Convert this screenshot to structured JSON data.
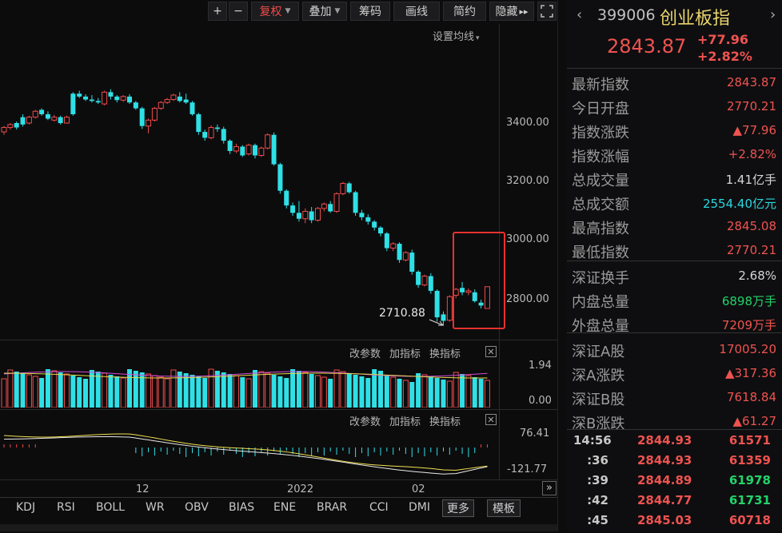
{
  "toolbar": {
    "plus": "+",
    "minus": "−",
    "fuquan": "复权",
    "diejia": "叠加",
    "chouma": "筹码",
    "huaxian": "画线",
    "jianyue": "简约",
    "yincang": "隐藏",
    "more_arrows": "▸▸"
  },
  "main_chart": {
    "ma_setting": "设置均线",
    "y_ticks": [
      "3400.00",
      "3200.00",
      "3000.00",
      "2800.00"
    ],
    "low_annotation": "2710.88",
    "highlight_color": "#e8322e"
  },
  "volume_panel": {
    "tools": [
      "改参数",
      "加指标",
      "换指标"
    ],
    "close": "✕",
    "y_ticks": [
      "1.94",
      "0.00"
    ]
  },
  "macd_panel": {
    "tools": [
      "改参数",
      "加指标",
      "换指标"
    ],
    "close": "✕",
    "y_ticks": [
      "76.41",
      "-121.77"
    ]
  },
  "x_axis": [
    "12",
    "2022",
    "02"
  ],
  "bottom_tabs": [
    "KDJ",
    "RSI",
    "BOLL",
    "WR",
    "OBV",
    "BIAS",
    "ENE",
    "BRAR",
    "CCI",
    "DMI",
    "更多",
    "模板"
  ],
  "expand": "»",
  "quote": {
    "code": "399006",
    "name": "创业板指",
    "price": "2843.87",
    "change": "+77.96",
    "pct": "+2.82%",
    "rows": [
      {
        "label": "最新指数",
        "value": "2843.87",
        "color": "red"
      },
      {
        "label": "今日开盘",
        "value": "2770.21",
        "color": "red"
      },
      {
        "label": "指数涨跌",
        "value": "▲77.96",
        "color": "red"
      },
      {
        "label": "指数涨幅",
        "value": "+2.82%",
        "color": "red"
      },
      {
        "label": "总成交量",
        "value": "1.41亿手",
        "color": "white"
      },
      {
        "label": "总成交额",
        "value": "2554.40亿元",
        "color": "cyan"
      },
      {
        "label": "最高指数",
        "value": "2845.08",
        "color": "red"
      },
      {
        "label": "最低指数",
        "value": "2770.21",
        "color": "red"
      },
      {
        "label": "深证换手",
        "value": "2.68%",
        "color": "white"
      },
      {
        "label": "内盘总量",
        "value": "6898万手",
        "color": "green"
      },
      {
        "label": "外盘总量",
        "value": "7209万手",
        "color": "red"
      },
      {
        "label": "深证A股",
        "value": "17005.20",
        "color": "red"
      },
      {
        "label": "深A涨跌",
        "value": "▲317.36",
        "color": "red"
      },
      {
        "label": "深证B股",
        "value": "7618.84",
        "color": "red"
      },
      {
        "label": "深B涨跌",
        "value": "▲61.27",
        "color": "red"
      }
    ],
    "ticks": [
      {
        "time": "14:56",
        "price": "2844.93",
        "vol": "61571",
        "color": "red"
      },
      {
        "time": ":36",
        "price": "2844.93",
        "vol": "61359",
        "color": "red"
      },
      {
        "time": ":39",
        "price": "2844.89",
        "vol": "61978",
        "color": "green"
      },
      {
        "time": ":42",
        "price": "2844.77",
        "vol": "61731",
        "color": "green"
      },
      {
        "time": ":45",
        "price": "2845.03",
        "vol": "60718",
        "color": "red"
      }
    ]
  },
  "chart_data": {
    "type": "candlestick",
    "y_ticks": [
      3400,
      3200,
      3000,
      2800
    ],
    "candles": [
      [
        3370,
        3385,
        3360,
        3390
      ],
      [
        3385,
        3395,
        3378,
        3400
      ],
      [
        3400,
        3385,
        3378,
        3405
      ],
      [
        3420,
        3395,
        3388,
        3430
      ],
      [
        3400,
        3420,
        3395,
        3425
      ],
      [
        3420,
        3440,
        3415,
        3445
      ],
      [
        3445,
        3430,
        3425,
        3450
      ],
      [
        3430,
        3415,
        3410,
        3440
      ],
      [
        3410,
        3420,
        3405,
        3428
      ],
      [
        3420,
        3400,
        3395,
        3425
      ],
      [
        3400,
        3420,
        3398,
        3425
      ],
      [
        3500,
        3430,
        3425,
        3505
      ],
      [
        3500,
        3490,
        3485,
        3510
      ],
      [
        3490,
        3480,
        3475,
        3498
      ],
      [
        3480,
        3475,
        3470,
        3495
      ],
      [
        3475,
        3470,
        3465,
        3485
      ],
      [
        3465,
        3505,
        3460,
        3510
      ],
      [
        3505,
        3490,
        3480,
        3515
      ],
      [
        3490,
        3478,
        3470,
        3495
      ],
      [
        3478,
        3490,
        3472,
        3495
      ],
      [
        3490,
        3470,
        3465,
        3498
      ],
      [
        3470,
        3450,
        3445,
        3475
      ],
      [
        3450,
        3390,
        3380,
        3455
      ],
      [
        3390,
        3410,
        3365,
        3415
      ],
      [
        3410,
        3450,
        3405,
        3455
      ],
      [
        3450,
        3470,
        3445,
        3475
      ],
      [
        3470,
        3480,
        3465,
        3485
      ],
      [
        3480,
        3495,
        3475,
        3500
      ],
      [
        3490,
        3475,
        3470,
        3505
      ],
      [
        3480,
        3470,
        3465,
        3500
      ],
      [
        3470,
        3430,
        3425,
        3475
      ],
      [
        3430,
        3370,
        3360,
        3435
      ],
      [
        3370,
        3350,
        3340,
        3378
      ],
      [
        3350,
        3385,
        3345,
        3392
      ],
      [
        3385,
        3380,
        3370,
        3395
      ],
      [
        3380,
        3340,
        3330,
        3388
      ],
      [
        3340,
        3305,
        3295,
        3345
      ],
      [
        3305,
        3320,
        3298,
        3330
      ],
      [
        3320,
        3290,
        3285,
        3325
      ],
      [
        3295,
        3325,
        3290,
        3330
      ],
      [
        3325,
        3290,
        3280,
        3330
      ],
      [
        3290,
        3315,
        3285,
        3320
      ],
      [
        3315,
        3360,
        3310,
        3365
      ],
      [
        3360,
        3260,
        3255,
        3368
      ],
      [
        3260,
        3170,
        3160,
        3265
      ],
      [
        3170,
        3120,
        3110,
        3175
      ],
      [
        3120,
        3095,
        3085,
        3130
      ],
      [
        3095,
        3075,
        3065,
        3135
      ],
      [
        3075,
        3100,
        3060,
        3110
      ],
      [
        3100,
        3070,
        3060,
        3115
      ],
      [
        3070,
        3110,
        3065,
        3115
      ],
      [
        3110,
        3125,
        3100,
        3130
      ],
      [
        3125,
        3100,
        3095,
        3135
      ],
      [
        3100,
        3160,
        3095,
        3165
      ],
      [
        3160,
        3195,
        3155,
        3200
      ],
      [
        3195,
        3165,
        3160,
        3200
      ],
      [
        3165,
        3095,
        3085,
        3170
      ],
      [
        3095,
        3080,
        3070,
        3105
      ],
      [
        3080,
        3065,
        3055,
        3090
      ],
      [
        3065,
        3045,
        3035,
        3070
      ],
      [
        3045,
        3025,
        3015,
        3050
      ],
      [
        3025,
        2975,
        2965,
        3030
      ],
      [
        2975,
        2990,
        2965,
        2995
      ],
      [
        2990,
        2935,
        2925,
        2995
      ],
      [
        2935,
        2960,
        2930,
        2965
      ],
      [
        2960,
        2895,
        2885,
        2970
      ],
      [
        2895,
        2850,
        2840,
        2900
      ],
      [
        2850,
        2880,
        2845,
        2885
      ],
      [
        2880,
        2830,
        2820,
        2890
      ],
      [
        2830,
        2740,
        2725,
        2835
      ],
      [
        2750,
        2728,
        2711,
        2760
      ],
      [
        2730,
        2810,
        2725,
        2815
      ],
      [
        2815,
        2835,
        2805,
        2840
      ],
      [
        2840,
        2825,
        2815,
        2860
      ],
      [
        2825,
        2830,
        2815,
        2838
      ],
      [
        2825,
        2795,
        2790,
        2835
      ],
      [
        2790,
        2780,
        2770,
        2800
      ],
      [
        2770,
        2844,
        2770,
        2845
      ]
    ]
  }
}
